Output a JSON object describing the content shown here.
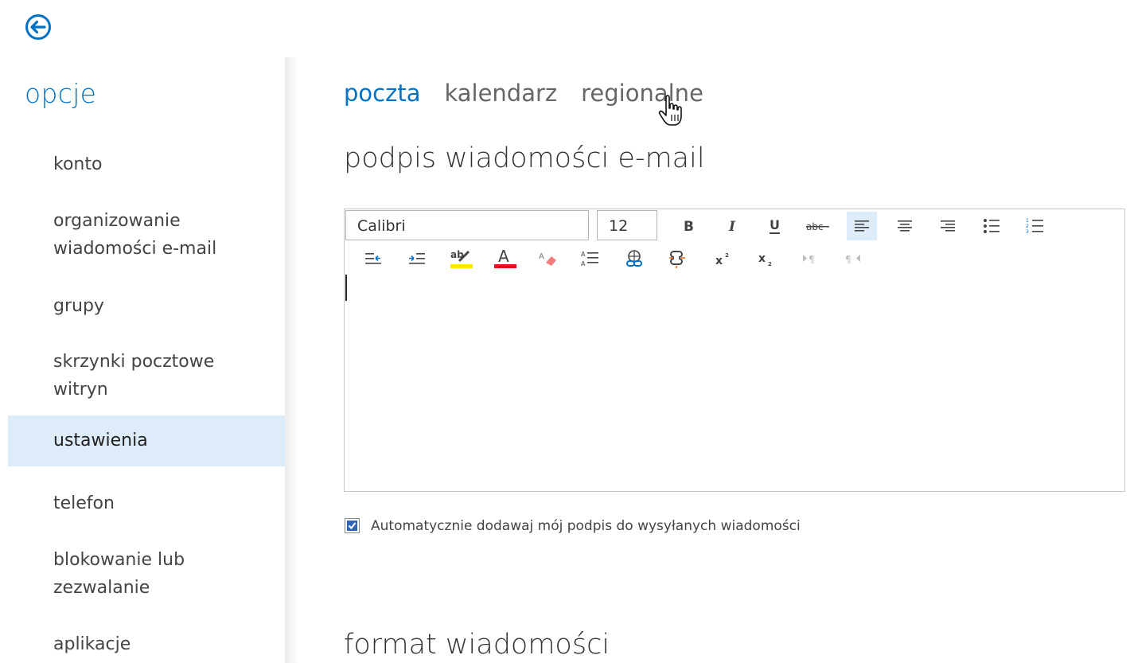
{
  "sidebar": {
    "title": "opcje",
    "items": [
      {
        "label": "konto"
      },
      {
        "label": "organizowanie wiadomości e-mail"
      },
      {
        "label": "grupy"
      },
      {
        "label": "skrzynki pocztowe witryn"
      },
      {
        "label": "ustawienia",
        "selected": true
      },
      {
        "label": "telefon"
      },
      {
        "label": "blokowanie lub zezwalanie"
      },
      {
        "label": "aplikacje"
      }
    ]
  },
  "tabs": [
    {
      "label": "poczta",
      "active": true
    },
    {
      "label": "kalendarz"
    },
    {
      "label": "regionalne"
    }
  ],
  "signature": {
    "heading": "podpis wiadomości e-mail",
    "font_name": "Calibri",
    "font_size": "12",
    "auto_add_label": "Automatycznie dodawaj mój podpis do wysyłanych wiadomości",
    "auto_add_checked": true
  },
  "format": {
    "heading": "format wiadomości"
  },
  "colors": {
    "accent": "#0072c6",
    "selected_bg": "#deecf9",
    "highlight_yellow": "#ffe600",
    "font_color_red": "#e81123"
  }
}
